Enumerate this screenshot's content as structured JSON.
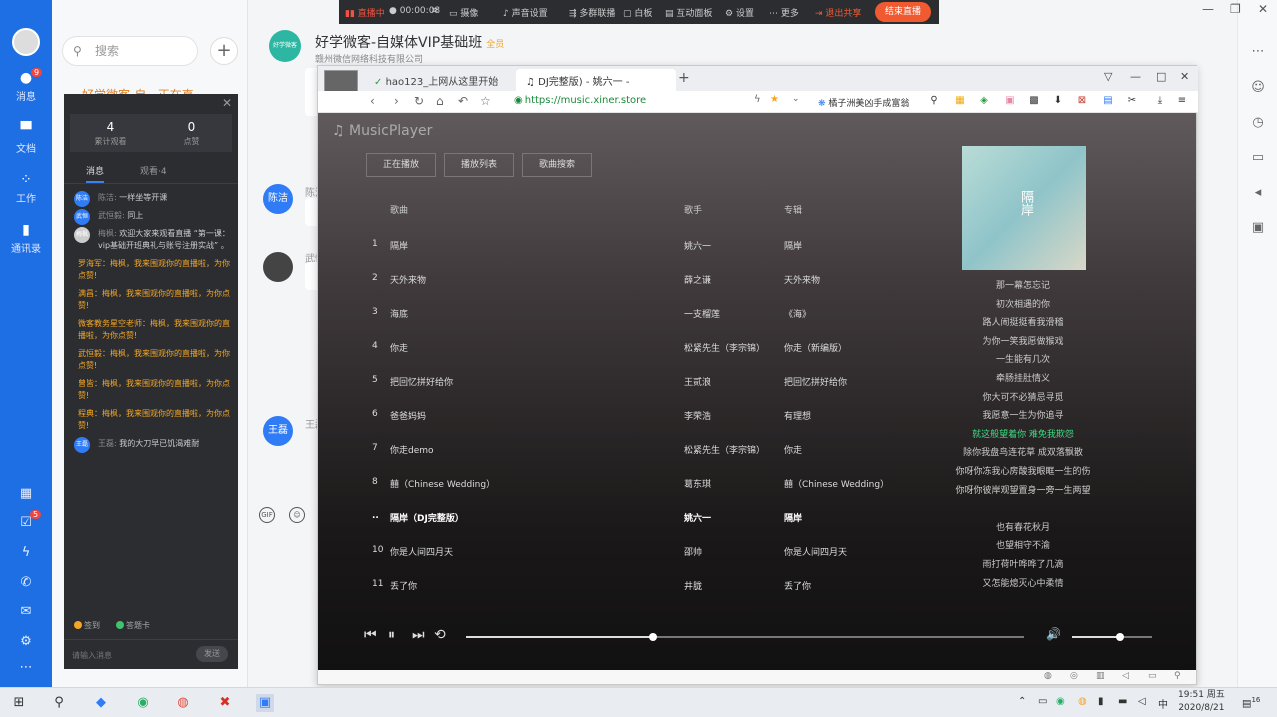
{
  "leftnav": {
    "items": [
      {
        "label": "消息",
        "badge": "9"
      },
      {
        "label": "文档"
      },
      {
        "label": "工作"
      },
      {
        "label": "通讯录"
      }
    ],
    "bottom_badge": "5"
  },
  "chatlist": {
    "search_placeholder": "搜索",
    "partial_row": "好学微客-自...正在直"
  },
  "livepanel": {
    "viewers": "4",
    "viewers_label": "累计观看",
    "likes": "0",
    "likes_label": "点赞",
    "tab_messages": "消息",
    "tab_viewers": "观看·4",
    "messages": [
      {
        "type": "sys",
        "avatar": "陈洁",
        "who": "陈洁: ",
        "text": "一样坐等开课"
      },
      {
        "type": "sys",
        "avatar": "武恒毅",
        "who": "武恒毅: ",
        "text": "同上"
      },
      {
        "type": "sys",
        "avatar": "梅枫",
        "who": "梅枫: ",
        "text": "欢迎大家来观看直播 “第一课：vip基础开班典礼与账号注册实战” 。"
      },
      {
        "type": "tip",
        "text": "罗海军：梅枫，我来围观你的直播啦，为你点赞!"
      },
      {
        "type": "tip",
        "text": "满昌：梅枫，我来围观你的直播啦，为你点赞!"
      },
      {
        "type": "tip",
        "text": "微客教务星空老师：梅枫，我来围观你的直播啦，为你点赞!"
      },
      {
        "type": "tip",
        "text": "武恒毅：梅枫，我来围观你的直播啦，为你点赞!"
      },
      {
        "type": "tip",
        "text": "曾皆：梅枫，我来围观你的直播啦，为你点赞!"
      },
      {
        "type": "tip",
        "text": "程典：梅枫，我来围观你的直播啦，为你点赞!"
      },
      {
        "type": "sys",
        "avatar": "王磊",
        "who": "王磊: ",
        "text": "我的大刀早已饥渴难耐"
      }
    ],
    "sign_in": "签到",
    "answer_card": "答题卡",
    "input_placeholder": "请输入消息",
    "send": "发送"
  },
  "chatmain": {
    "group_avatar": "好学微客",
    "title": "好学微客-自媒体VIP基础班",
    "member_tag": "全员",
    "subtitle": "赣州微信网络科技有限公司",
    "user1_avatar": "陈洁",
    "user1_name": "陈洁",
    "user2_name": "武恒",
    "user3_avatar": "王磊",
    "user3_name": "王磊",
    "gif_label": "GIF"
  },
  "livebar": {
    "live_label": "直播中",
    "timer": "00:00:08",
    "network": "网络",
    "camera": "摄像",
    "sound": "声音设置",
    "multi": "多群联播",
    "whiteboard": "白板",
    "interactive": "互动面板",
    "settings": "设置",
    "more": "更多",
    "exit_share": "退出共享",
    "stop_live": "结束直播"
  },
  "browser": {
    "tab1": "hao123_上网从这里开始",
    "tab2": "DJ完整版) - 姚六一 -",
    "url": "https://music.xiner.store",
    "bookmark": "橘子洲美凶手成富翁"
  },
  "player": {
    "title": "♫ MusicPlayer",
    "btn_now": "正在播放",
    "btn_list": "播放列表",
    "btn_search": "歌曲搜索",
    "col_song": "歌曲",
    "col_artist": "歌手",
    "col_album": "专辑",
    "songs": [
      {
        "no": "1",
        "song": "隔岸",
        "artist": "姚六一",
        "album": "隔岸"
      },
      {
        "no": "2",
        "song": "天外来物",
        "artist": "薛之谦",
        "album": "天外来物"
      },
      {
        "no": "3",
        "song": "海底",
        "artist": "一支榴莲",
        "album": "《海》"
      },
      {
        "no": "4",
        "song": "你走",
        "artist": "松紧先生（李宗锦）",
        "album": "你走（新编版）"
      },
      {
        "no": "5",
        "song": "把回忆拼好给你",
        "artist": "王贰浪",
        "album": "把回忆拼好给你"
      },
      {
        "no": "6",
        "song": "爸爸妈妈",
        "artist": "李荣浩",
        "album": "有理想"
      },
      {
        "no": "7",
        "song": "你走demo",
        "artist": "松紧先生（李宗锦）",
        "album": "你走"
      },
      {
        "no": "8",
        "song": "囍（Chinese Wedding）",
        "artist": "葛东琪",
        "album": "囍（Chinese Wedding）"
      },
      {
        "no": "..",
        "song": "隔岸（DJ完整版）",
        "artist": "姚六一",
        "album": "隔岸"
      },
      {
        "no": "10",
        "song": "你是人间四月天",
        "artist": "邵帅",
        "album": "你是人间四月天"
      },
      {
        "no": "11",
        "song": "丢了你",
        "artist": "井胧",
        "album": "丢了你"
      }
    ],
    "album_title": "隔岸",
    "lyrics": [
      "那一幕怎忘记",
      "初次相遇的你",
      "路人闹挺挺看我滑稽",
      "为你一笑我愿做猴戏",
      "一生能有几次",
      "牵肠挂肚情义",
      "你大可不必猜忌寻觅",
      "我愿意一生为你追寻",
      "就这般望着你 难免我欺怨",
      "除你我盘鸟连花草 成双落飘散",
      "你呀你冻我心房酸我眼眶一生的伤",
      "你呀你彼岸观望置身一旁一生两望",
      "",
      "也有春花秋月",
      "也望相守不渝",
      "雨打荷叶哗哗了几滴",
      "又怎能熄灭心中柔情"
    ],
    "highlight_index": 8,
    "progress": 0.335,
    "volume": 0.6
  },
  "taskbar": {
    "time": "19:51 周五",
    "date": "2020/8/21",
    "ime": "中",
    "notif_count": "16"
  }
}
